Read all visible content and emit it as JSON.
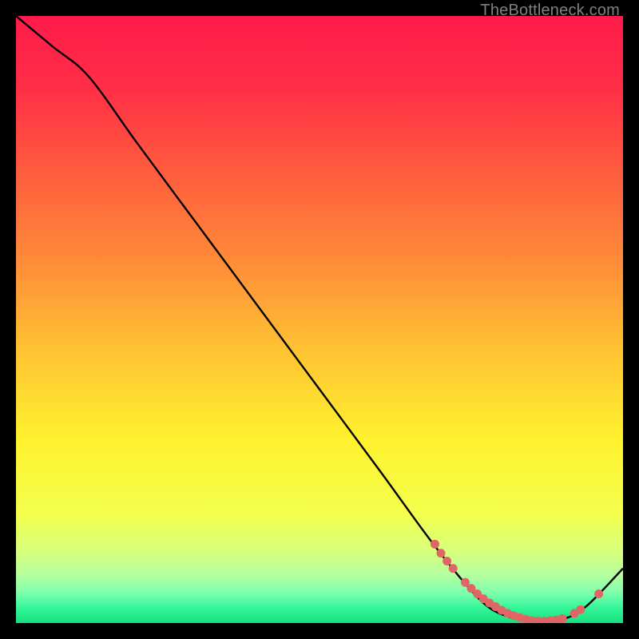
{
  "watermark": "TheBottleneck.com",
  "chart_data": {
    "type": "line",
    "title": "",
    "xlabel": "",
    "ylabel": "",
    "xlim": [
      0,
      100
    ],
    "ylim": [
      0,
      100
    ],
    "grid": false,
    "legend": false,
    "series": [
      {
        "name": "curve",
        "x": [
          0,
          6,
          12,
          20,
          30,
          40,
          50,
          60,
          68,
          74,
          78,
          82,
          86,
          90,
          94,
          100
        ],
        "y": [
          100,
          95,
          90,
          79,
          65.5,
          52,
          38.5,
          25,
          14,
          6.5,
          2.5,
          0.8,
          0.3,
          0.6,
          2.8,
          9
        ]
      }
    ],
    "markers": {
      "name": "highlight-dots",
      "color": "#e06666",
      "x": [
        69,
        70,
        71,
        72,
        74,
        75,
        76,
        77,
        78,
        79,
        80,
        81,
        82,
        83,
        84,
        85,
        86,
        87,
        88,
        89,
        90,
        92,
        93,
        96
      ],
      "y": [
        13,
        11.5,
        10.2,
        9,
        6.7,
        5.7,
        4.8,
        4.0,
        3.3,
        2.7,
        2.1,
        1.6,
        1.2,
        0.9,
        0.6,
        0.4,
        0.3,
        0.3,
        0.4,
        0.5,
        0.7,
        1.6,
        2.2,
        4.8
      ]
    },
    "gradient_stops": [
      {
        "offset": 0.0,
        "color": "#ff1a4b"
      },
      {
        "offset": 0.12,
        "color": "#ff2f46"
      },
      {
        "offset": 0.25,
        "color": "#ff5a3f"
      },
      {
        "offset": 0.4,
        "color": "#ff8a38"
      },
      {
        "offset": 0.55,
        "color": "#ffc233"
      },
      {
        "offset": 0.7,
        "color": "#fff22e"
      },
      {
        "offset": 0.82,
        "color": "#f3ff4d"
      },
      {
        "offset": 0.88,
        "color": "#d8ff7a"
      },
      {
        "offset": 0.92,
        "color": "#b6ff9e"
      },
      {
        "offset": 0.95,
        "color": "#7dffad"
      },
      {
        "offset": 0.975,
        "color": "#34f59a"
      },
      {
        "offset": 1.0,
        "color": "#16e07e"
      }
    ]
  }
}
